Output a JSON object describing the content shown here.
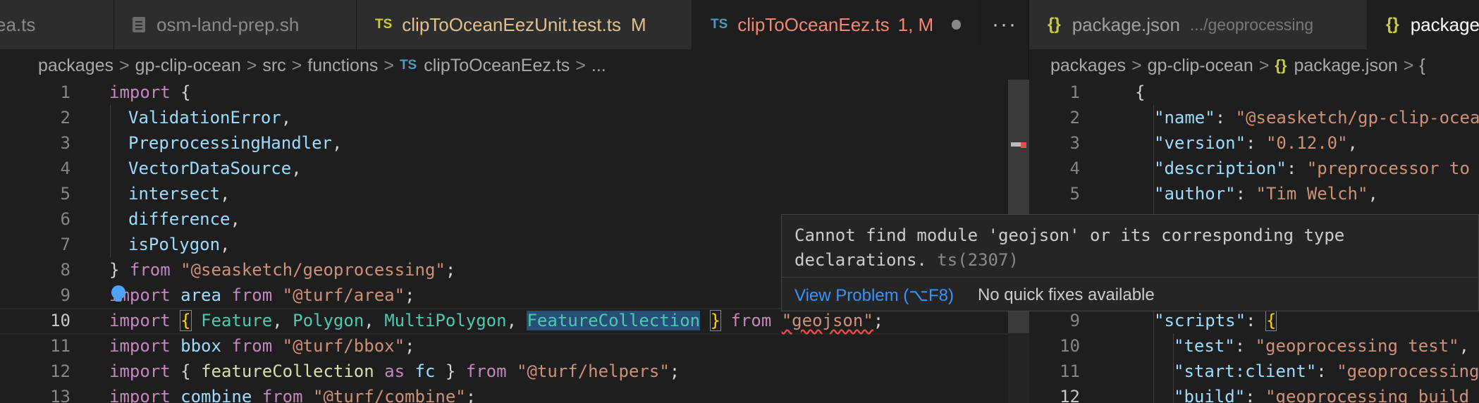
{
  "tabs_left": [
    {
      "label": "ea.ts",
      "kind": "ts-partial",
      "color": "#8a8a8a"
    },
    {
      "label": "osm-land-prep.sh",
      "kind": "file",
      "color": "#8a8a8a"
    },
    {
      "label": "clipToOceanEezUnit.test.ts",
      "kind": "ts",
      "status": "M",
      "color": "#e2c08d"
    },
    {
      "label": "clipToOceanEez.ts",
      "kind": "ts",
      "status": "1, M",
      "color": "#f48771",
      "active": true
    }
  ],
  "tabs_right": [
    {
      "label": "package.json",
      "detail": ".../geoprocessing"
    },
    {
      "label": "package"
    }
  ],
  "ts_badge": "TS",
  "json_badge": "{}",
  "more_actions": "···",
  "breadcrumb_left": [
    "packages",
    "gp-clip-ocean",
    "src",
    "functions",
    "clipToOceanEez.ts",
    "..."
  ],
  "breadcrumb_right": [
    "packages",
    "gp-clip-ocean",
    "package.json",
    "{"
  ],
  "code_left_lines": [
    1,
    2,
    3,
    4,
    5,
    6,
    7,
    8,
    9,
    10,
    11,
    12,
    13
  ],
  "code_right_lines": [
    1,
    2,
    3,
    4,
    5,
    9,
    10,
    11,
    12
  ],
  "hover": {
    "message_line1": "Cannot find module 'geojson' or its corresponding type",
    "message_line2": "declarations.",
    "code": "ts(2307)",
    "view_problem": "View Problem (⌥F8)",
    "no_fixes": "No quick fixes available"
  },
  "colors": {
    "error": "#f14c4c",
    "link": "#3794ff",
    "modified": "#e2c08d"
  }
}
